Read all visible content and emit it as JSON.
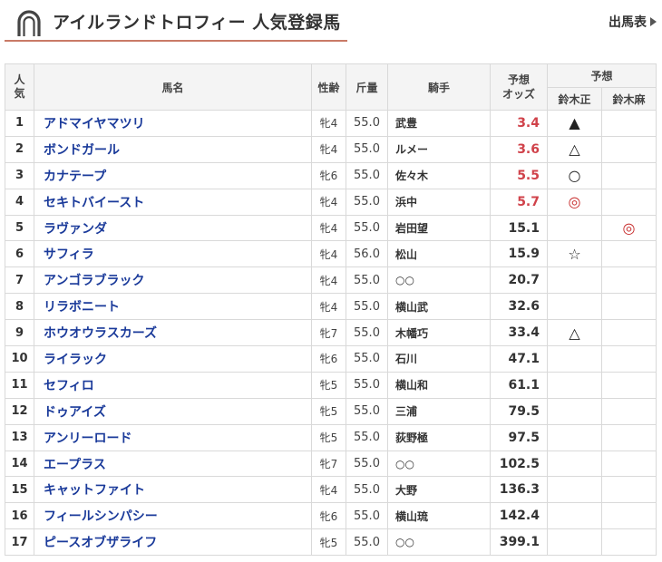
{
  "header": {
    "title": "アイルランドトロフィー 人気登録馬",
    "link_label": "出馬表"
  },
  "table": {
    "headers": {
      "rank": "人\n気",
      "name": "馬名",
      "sex_age": "性齢",
      "weight": "斤量",
      "jockey": "騎手",
      "odds": "予想\nオッズ",
      "prediction_group": "予想",
      "predictor1": "鈴木正",
      "predictor2": "鈴木麻"
    },
    "rows": [
      {
        "rank": "1",
        "name": "アドマイヤマツリ",
        "sex_age": "牝4",
        "weight": "55.0",
        "jockey": "武豊",
        "odds": "3.4",
        "hot": true,
        "mark1": "▲",
        "mark2": ""
      },
      {
        "rank": "2",
        "name": "ボンドガール",
        "sex_age": "牝4",
        "weight": "55.0",
        "jockey": "ルメー",
        "odds": "3.6",
        "hot": true,
        "mark1": "△",
        "mark2": ""
      },
      {
        "rank": "3",
        "name": "カナテープ",
        "sex_age": "牝6",
        "weight": "55.0",
        "jockey": "佐々木",
        "odds": "5.5",
        "hot": true,
        "mark1": "○",
        "mark2": ""
      },
      {
        "rank": "4",
        "name": "セキトバイースト",
        "sex_age": "牝4",
        "weight": "55.0",
        "jockey": "浜中",
        "odds": "5.7",
        "hot": true,
        "mark1": "◎",
        "mark2": ""
      },
      {
        "rank": "5",
        "name": "ラヴァンダ",
        "sex_age": "牝4",
        "weight": "55.0",
        "jockey": "岩田望",
        "odds": "15.1",
        "hot": false,
        "mark1": "",
        "mark2": "◎"
      },
      {
        "rank": "6",
        "name": "サフィラ",
        "sex_age": "牝4",
        "weight": "56.0",
        "jockey": "松山",
        "odds": "15.9",
        "hot": false,
        "mark1": "☆",
        "mark2": ""
      },
      {
        "rank": "7",
        "name": "アンゴラブラック",
        "sex_age": "牝4",
        "weight": "55.0",
        "jockey": "○○",
        "odds": "20.7",
        "hot": false,
        "mark1": "",
        "mark2": ""
      },
      {
        "rank": "8",
        "name": "リラボニート",
        "sex_age": "牝4",
        "weight": "55.0",
        "jockey": "横山武",
        "odds": "32.6",
        "hot": false,
        "mark1": "",
        "mark2": ""
      },
      {
        "rank": "9",
        "name": "ホウオウラスカーズ",
        "sex_age": "牝7",
        "weight": "55.0",
        "jockey": "木幡巧",
        "odds": "33.4",
        "hot": false,
        "mark1": "△",
        "mark2": ""
      },
      {
        "rank": "10",
        "name": "ライラック",
        "sex_age": "牝6",
        "weight": "55.0",
        "jockey": "石川",
        "odds": "47.1",
        "hot": false,
        "mark1": "",
        "mark2": ""
      },
      {
        "rank": "11",
        "name": "セフィロ",
        "sex_age": "牝5",
        "weight": "55.0",
        "jockey": "横山和",
        "odds": "61.1",
        "hot": false,
        "mark1": "",
        "mark2": ""
      },
      {
        "rank": "12",
        "name": "ドゥアイズ",
        "sex_age": "牝5",
        "weight": "55.0",
        "jockey": "三浦",
        "odds": "79.5",
        "hot": false,
        "mark1": "",
        "mark2": ""
      },
      {
        "rank": "13",
        "name": "アンリーロード",
        "sex_age": "牝5",
        "weight": "55.0",
        "jockey": "荻野極",
        "odds": "97.5",
        "hot": false,
        "mark1": "",
        "mark2": ""
      },
      {
        "rank": "14",
        "name": "エープラス",
        "sex_age": "牝7",
        "weight": "55.0",
        "jockey": "○○",
        "odds": "102.5",
        "hot": false,
        "mark1": "",
        "mark2": ""
      },
      {
        "rank": "15",
        "name": "キャットファイト",
        "sex_age": "牝4",
        "weight": "55.0",
        "jockey": "大野",
        "odds": "136.3",
        "hot": false,
        "mark1": "",
        "mark2": ""
      },
      {
        "rank": "16",
        "name": "フィールシンパシー",
        "sex_age": "牝6",
        "weight": "55.0",
        "jockey": "横山琉",
        "odds": "142.4",
        "hot": false,
        "mark1": "",
        "mark2": ""
      },
      {
        "rank": "17",
        "name": "ピースオブザライフ",
        "sex_age": "牝5",
        "weight": "55.0",
        "jockey": "○○",
        "odds": "399.1",
        "hot": false,
        "mark1": "",
        "mark2": ""
      }
    ]
  },
  "colors": {
    "accent_line": "#c97a66",
    "horse_name": "#1a3a9a",
    "hot_odds": "#d0424a"
  },
  "icons": {
    "logo": "horseshoe-icon",
    "link_arrow": "triangle-right-icon"
  }
}
